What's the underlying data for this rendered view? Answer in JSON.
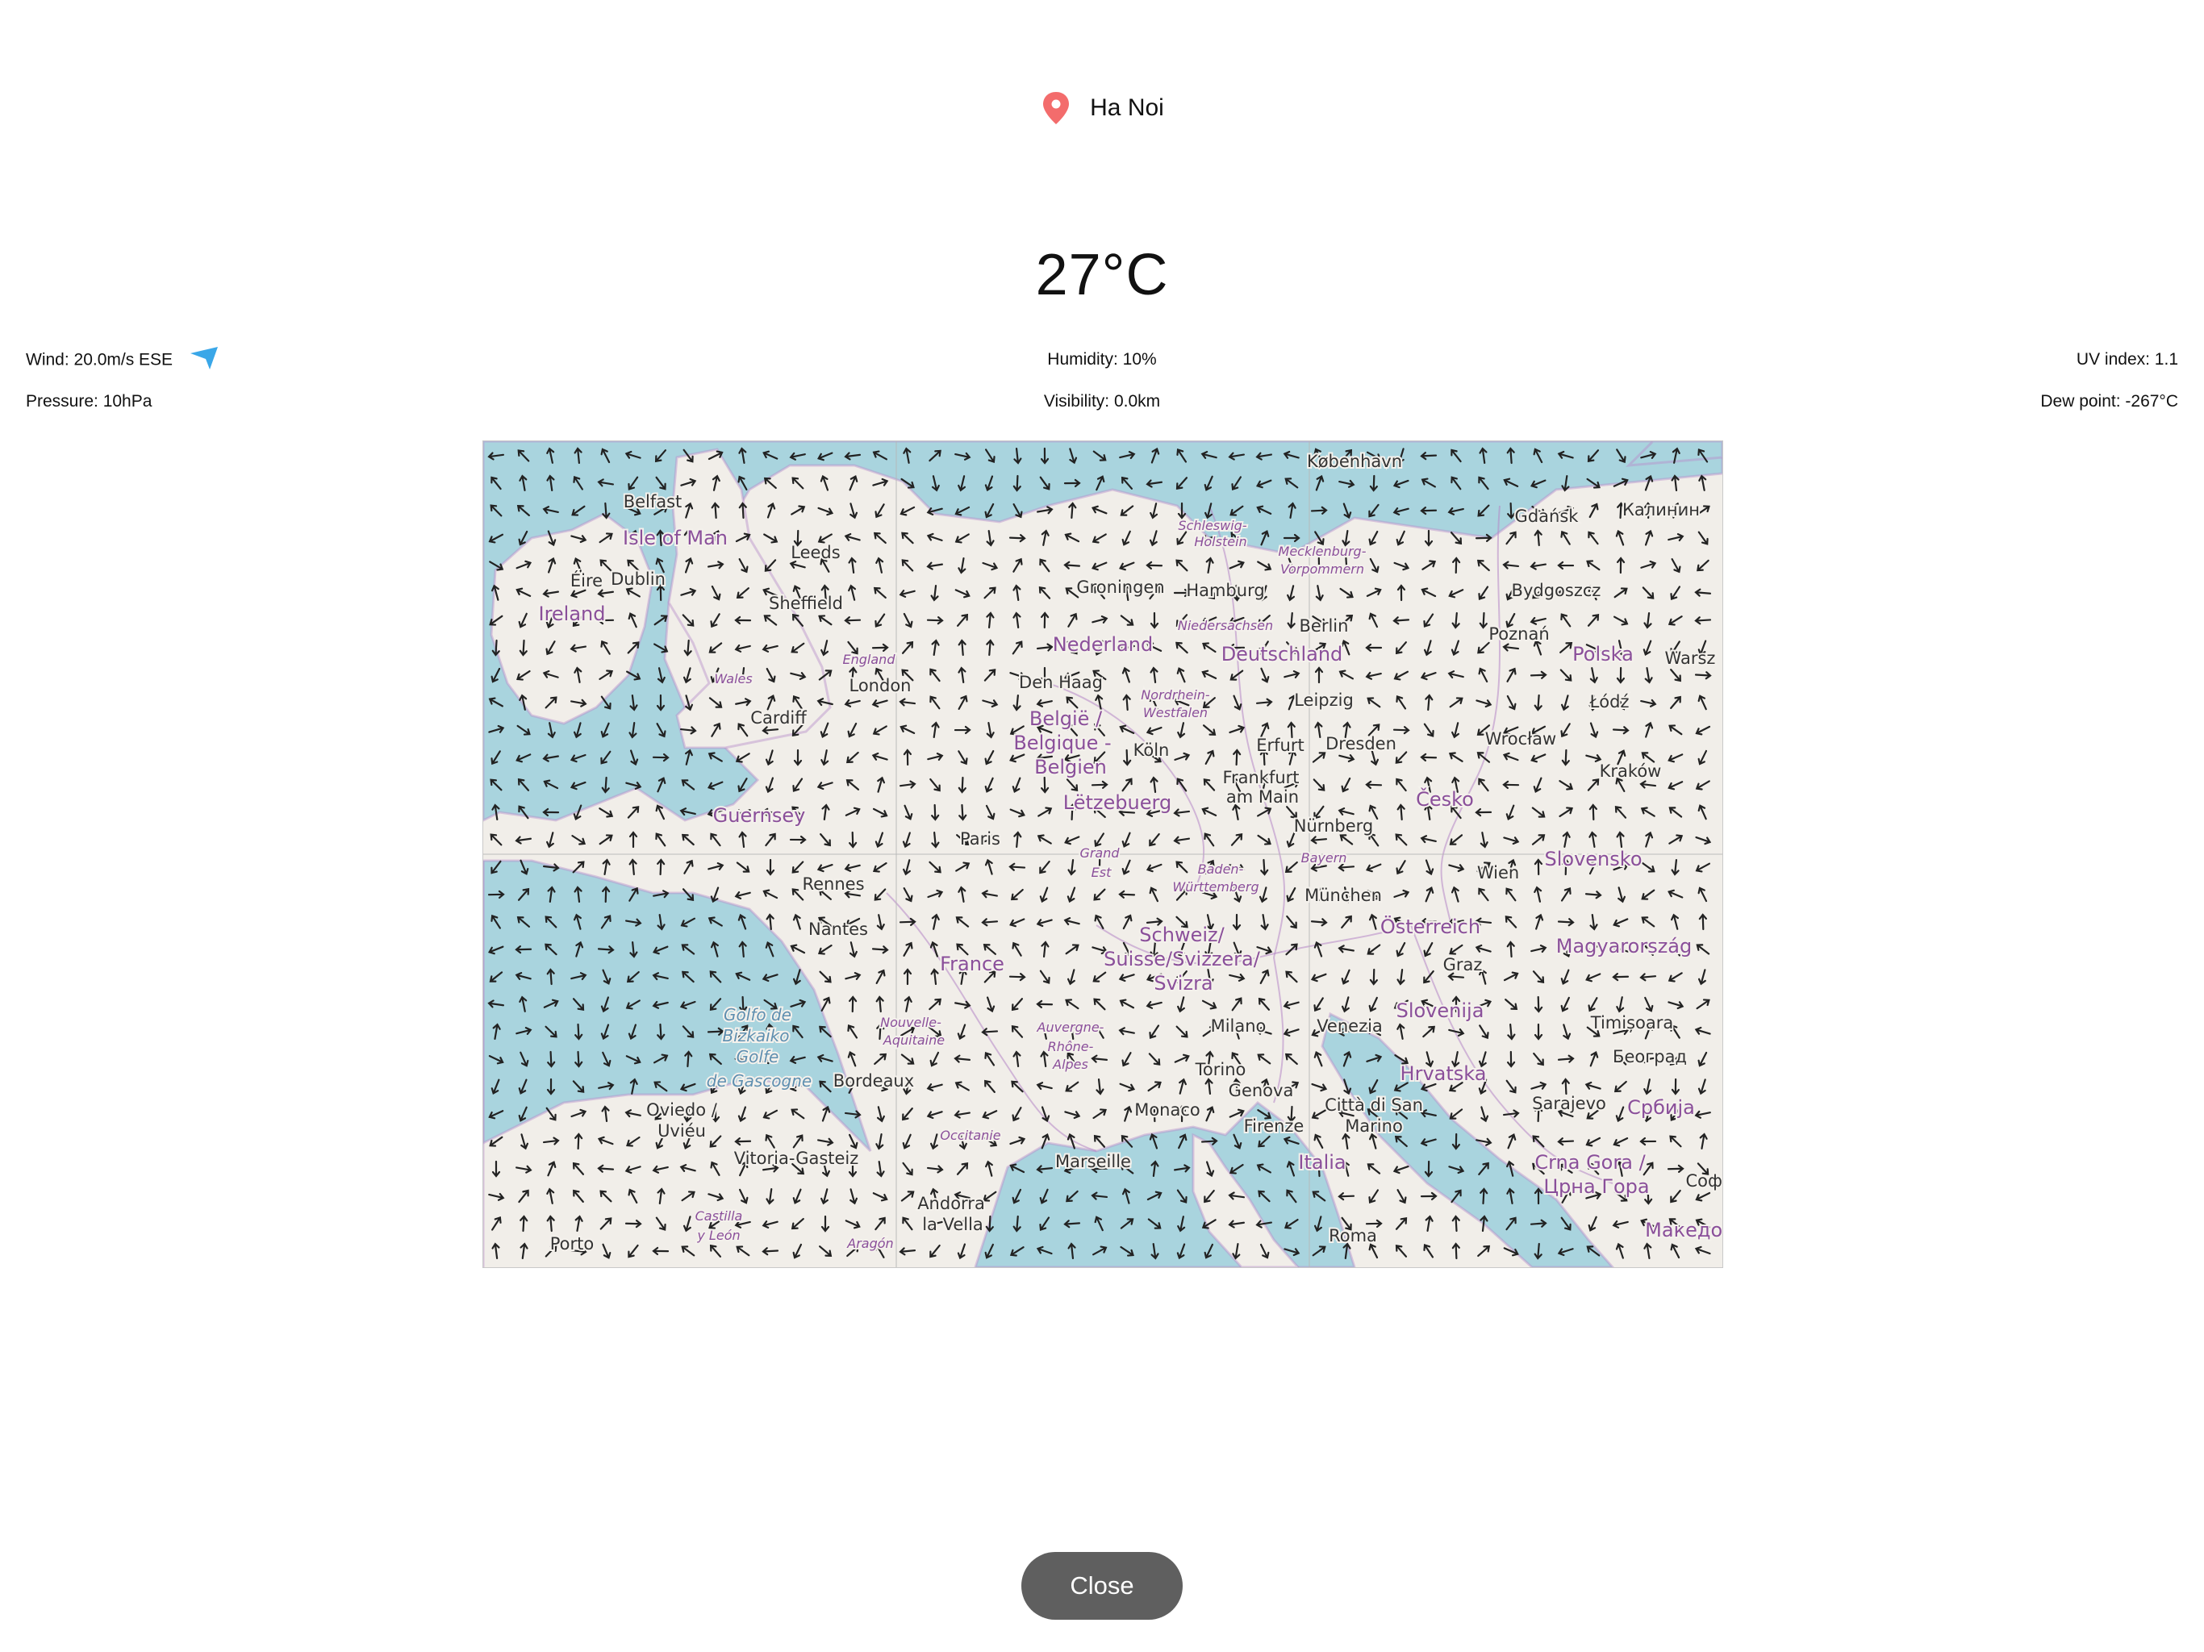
{
  "location": {
    "name": "Ha Noi",
    "icon": "map-pin-icon",
    "icon_color": "#f36c6c"
  },
  "weather": {
    "temperature": "27°C",
    "wind": "Wind: 20.0m/s ESE",
    "humidity": "Humidity: 10%",
    "uv_index": "UV index: 1.1",
    "pressure": "Pressure: 10hPa",
    "visibility": "Visibility: 0.0km",
    "dew_point": "Dew point: -267°C",
    "wind_icon": "wind-direction-arrow-icon",
    "wind_icon_color": "#3aa7e8"
  },
  "map": {
    "labels": [
      {
        "id": "kobenhavn",
        "text": "København",
        "kind": "city"
      },
      {
        "id": "gdansk",
        "text": "Gdańsk",
        "kind": "city"
      },
      {
        "id": "kaliningrad",
        "text": "Калинин",
        "kind": "city"
      },
      {
        "id": "belfast",
        "text": "Belfast",
        "kind": "city"
      },
      {
        "id": "isle-of-man",
        "text": "Isle of Man",
        "kind": "region"
      },
      {
        "id": "leeds",
        "text": "Leeds",
        "kind": "city"
      },
      {
        "id": "schleswig",
        "text": "Schleswig-",
        "kind": "small"
      },
      {
        "id": "holstein",
        "text": "Holstein",
        "kind": "small"
      },
      {
        "id": "mecklenburg",
        "text": "Mecklenburg-",
        "kind": "small"
      },
      {
        "id": "vorpommern",
        "text": "Vorpommern",
        "kind": "small"
      },
      {
        "id": "eire",
        "text": "Éire",
        "kind": "city"
      },
      {
        "id": "dublin",
        "text": "Dublin",
        "kind": "city"
      },
      {
        "id": "groningen",
        "text": "Groningen",
        "kind": "city"
      },
      {
        "id": "hamburg",
        "text": "Hamburg",
        "kind": "city"
      },
      {
        "id": "bydgoszcz",
        "text": "Bydgoszcz",
        "kind": "city"
      },
      {
        "id": "ireland",
        "text": "Ireland",
        "kind": "region"
      },
      {
        "id": "sheffield",
        "text": "Sheffield",
        "kind": "city"
      },
      {
        "id": "berlin",
        "text": "Berlin",
        "kind": "city"
      },
      {
        "id": "niedersachsen",
        "text": "Niedersachsen",
        "kind": "small"
      },
      {
        "id": "poznan",
        "text": "Poznań",
        "kind": "city"
      },
      {
        "id": "nederland",
        "text": "Nederland",
        "kind": "region"
      },
      {
        "id": "deutschland",
        "text": "Deutschland",
        "kind": "region"
      },
      {
        "id": "polska",
        "text": "Polska",
        "kind": "region"
      },
      {
        "id": "warszawa",
        "text": "Warsz",
        "kind": "city"
      },
      {
        "id": "england",
        "text": "England",
        "kind": "small"
      },
      {
        "id": "wales",
        "text": "Wales",
        "kind": "small"
      },
      {
        "id": "london",
        "text": "London",
        "kind": "city"
      },
      {
        "id": "den-haag",
        "text": "Den Haag",
        "kind": "city"
      },
      {
        "id": "nordrhein",
        "text": "Nordrhein-",
        "kind": "small"
      },
      {
        "id": "westfalen",
        "text": "Westfalen",
        "kind": "small"
      },
      {
        "id": "leipzig",
        "text": "Leipzig",
        "kind": "city"
      },
      {
        "id": "lodz",
        "text": "Łódź",
        "kind": "city"
      },
      {
        "id": "cardiff",
        "text": "Cardiff",
        "kind": "city"
      },
      {
        "id": "belgie",
        "text": "België /",
        "kind": "region"
      },
      {
        "id": "belgique",
        "text": "Belgique -",
        "kind": "region"
      },
      {
        "id": "belgien",
        "text": "Belgien",
        "kind": "region"
      },
      {
        "id": "koln",
        "text": "Köln",
        "kind": "city"
      },
      {
        "id": "erfurt",
        "text": "Erfurt",
        "kind": "city"
      },
      {
        "id": "dresden",
        "text": "Dresden",
        "kind": "city"
      },
      {
        "id": "wroclaw",
        "text": "Wrocław",
        "kind": "city"
      },
      {
        "id": "frankfurt",
        "text": "Frankfurt",
        "kind": "city"
      },
      {
        "id": "am-main",
        "text": "am Main",
        "kind": "city"
      },
      {
        "id": "krakow",
        "text": "Kraków",
        "kind": "city"
      },
      {
        "id": "guernsey",
        "text": "Guernsey",
        "kind": "region"
      },
      {
        "id": "letzebuerg",
        "text": "Lëtzebuerg",
        "kind": "region"
      },
      {
        "id": "cesko",
        "text": "Česko",
        "kind": "region"
      },
      {
        "id": "nurnberg",
        "text": "Nürnberg",
        "kind": "city"
      },
      {
        "id": "paris",
        "text": "Paris",
        "kind": "city"
      },
      {
        "id": "grand",
        "text": "Grand",
        "kind": "small"
      },
      {
        "id": "est",
        "text": "Est",
        "kind": "small"
      },
      {
        "id": "baden",
        "text": "Baden-",
        "kind": "small"
      },
      {
        "id": "wurttemberg",
        "text": "Württemberg",
        "kind": "small"
      },
      {
        "id": "bayern",
        "text": "Bayern",
        "kind": "small"
      },
      {
        "id": "slovensko",
        "text": "Slovensko",
        "kind": "region"
      },
      {
        "id": "rennes",
        "text": "Rennes",
        "kind": "city"
      },
      {
        "id": "wien",
        "text": "Wien",
        "kind": "city"
      },
      {
        "id": "munchen",
        "text": "München",
        "kind": "city"
      },
      {
        "id": "nantes",
        "text": "Nantes",
        "kind": "city"
      },
      {
        "id": "schweiz",
        "text": "Schweiz/",
        "kind": "region"
      },
      {
        "id": "osterreich",
        "text": "Österreich",
        "kind": "region"
      },
      {
        "id": "magyarorszag",
        "text": "Magyarország",
        "kind": "region"
      },
      {
        "id": "france",
        "text": "France",
        "kind": "region"
      },
      {
        "id": "suisse",
        "text": "Suisse/Svizzera/",
        "kind": "region"
      },
      {
        "id": "graz",
        "text": "Graz",
        "kind": "city"
      },
      {
        "id": "svizra",
        "text": "Svizra",
        "kind": "region"
      },
      {
        "id": "golfo",
        "text": "Golfo de",
        "kind": "water"
      },
      {
        "id": "bizkaia",
        "text": "Bizkaiko",
        "kind": "water"
      },
      {
        "id": "golfe",
        "text": "Golfe",
        "kind": "water"
      },
      {
        "id": "gascogne",
        "text": "de Gascogne",
        "kind": "water"
      },
      {
        "id": "nouvelle",
        "text": "Nouvelle-",
        "kind": "small"
      },
      {
        "id": "aquitaine",
        "text": "Aquitaine",
        "kind": "small"
      },
      {
        "id": "slovenija",
        "text": "Slovenija",
        "kind": "region"
      },
      {
        "id": "timisoara",
        "text": "Timișoara",
        "kind": "city"
      },
      {
        "id": "auvergne",
        "text": "Auvergne-",
        "kind": "small"
      },
      {
        "id": "rhone",
        "text": "Rhône-",
        "kind": "small"
      },
      {
        "id": "alpes",
        "text": "Alpes",
        "kind": "small"
      },
      {
        "id": "milano",
        "text": "Milano",
        "kind": "city"
      },
      {
        "id": "venezia",
        "text": "Venezia",
        "kind": "city"
      },
      {
        "id": "beograd",
        "text": "Београд",
        "kind": "city"
      },
      {
        "id": "bordeaux",
        "text": "Bordeaux",
        "kind": "city"
      },
      {
        "id": "torino",
        "text": "Torino",
        "kind": "city"
      },
      {
        "id": "hrvatska",
        "text": "Hrvatska",
        "kind": "region"
      },
      {
        "id": "genova",
        "text": "Genova",
        "kind": "city"
      },
      {
        "id": "oviedo",
        "text": "Oviedo /",
        "kind": "city"
      },
      {
        "id": "uvieu",
        "text": "Uviéu",
        "kind": "city"
      },
      {
        "id": "monaco",
        "text": "Monaco",
        "kind": "city"
      },
      {
        "id": "citta-san",
        "text": "Città di San",
        "kind": "city"
      },
      {
        "id": "sarajevo",
        "text": "Sarajevo",
        "kind": "city"
      },
      {
        "id": "srbija",
        "text": "Србија",
        "kind": "region"
      },
      {
        "id": "occitanie",
        "text": "Occitanie",
        "kind": "small"
      },
      {
        "id": "firenze",
        "text": "Firenze",
        "kind": "city"
      },
      {
        "id": "marino",
        "text": "Marino",
        "kind": "city"
      },
      {
        "id": "vitoria",
        "text": "Vitoria-Gasteiz",
        "kind": "city"
      },
      {
        "id": "marseille",
        "text": "Marseille",
        "kind": "city"
      },
      {
        "id": "italia",
        "text": "Italia",
        "kind": "region"
      },
      {
        "id": "crna-gora",
        "text": "Crna Gora /",
        "kind": "region"
      },
      {
        "id": "sofia",
        "text": "Софи",
        "kind": "city"
      },
      {
        "id": "crna-gora-cyr",
        "text": "Црна Гора",
        "kind": "region"
      },
      {
        "id": "andorra",
        "text": "Andorra",
        "kind": "city"
      },
      {
        "id": "la-vella",
        "text": "la Vella",
        "kind": "city"
      },
      {
        "id": "castilla",
        "text": "Castilla",
        "kind": "small"
      },
      {
        "id": "y-leon",
        "text": "y León",
        "kind": "small"
      },
      {
        "id": "porto",
        "text": "Porto",
        "kind": "city"
      },
      {
        "id": "aragon",
        "text": "Aragón",
        "kind": "small"
      },
      {
        "id": "roma",
        "text": "Roma",
        "kind": "city"
      },
      {
        "id": "makedonija",
        "text": "Македон",
        "kind": "region"
      }
    ]
  },
  "buttons": {
    "close": "Close"
  }
}
